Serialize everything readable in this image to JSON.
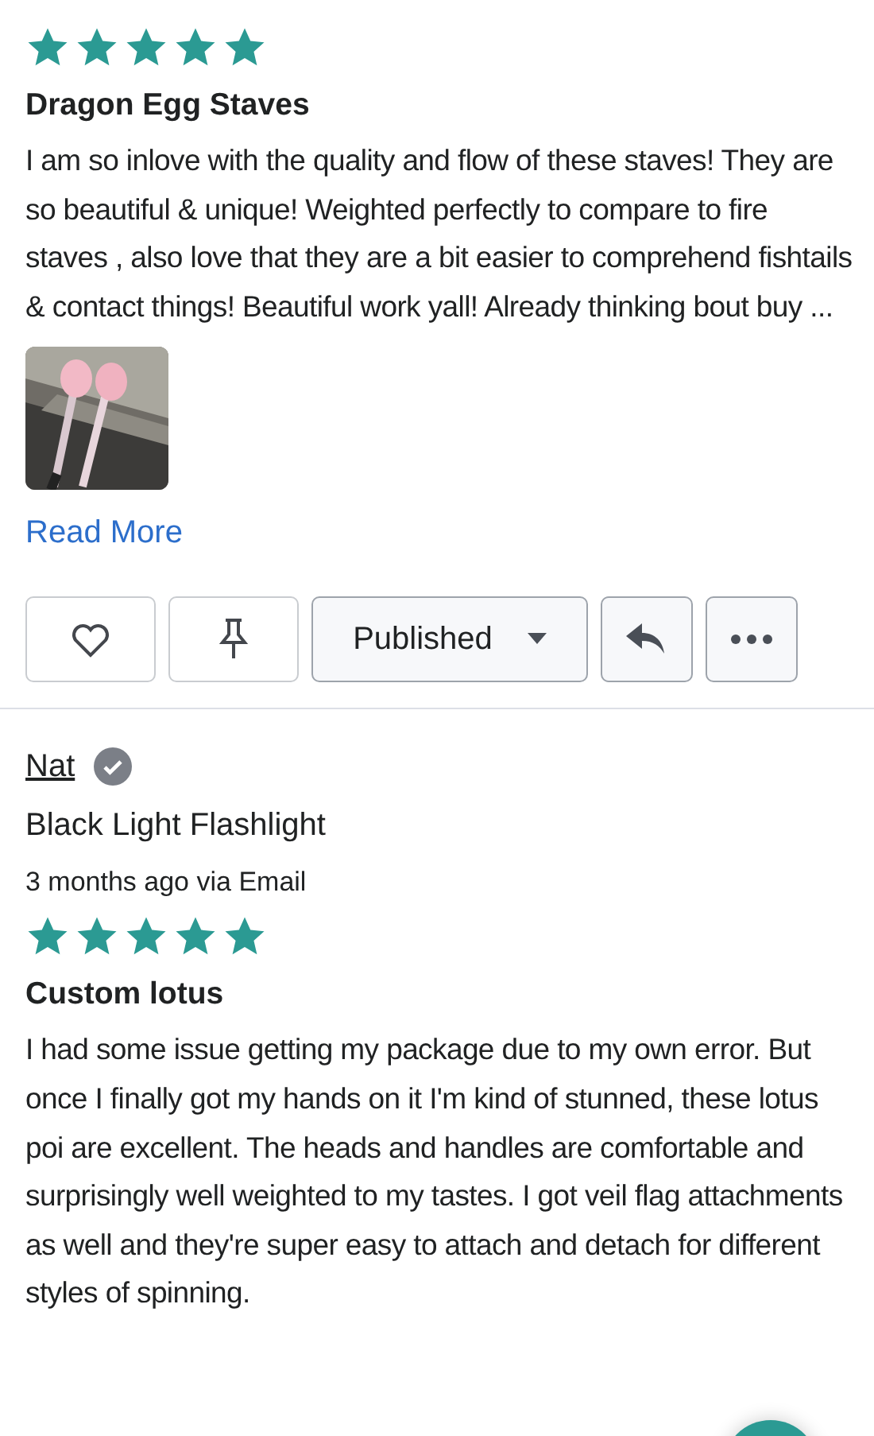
{
  "reviews": [
    {
      "stars": 5,
      "title": "Dragon Egg Staves",
      "body": "I am so inlove with the quality and flow of these staves! They are so beautiful & unique! Weighted perfectly to compare to fire staves , also love that they are a bit easier to comprehend fishtails & contact things! Beautiful work yall! Already thinking bout buy ...",
      "photos": [
        {
          "kind": "picture"
        }
      ],
      "read_more": "Read More",
      "actions": {
        "status": "Published"
      }
    },
    {
      "author": "Nat",
      "verified": true,
      "product": "Black Light Flashlight",
      "meta": "3 months ago via Email",
      "stars": 5,
      "title": "Custom lotus",
      "body": "I had some issue getting my package due to my own error. But once I finally got my hands on it I'm kind of stunned, these lotus poi are excellent. The heads and handles are comfortable and surprisingly well weighted to my tastes. I got veil flag attachments as well and they're super easy to attach and detach for different styles of spinning."
    }
  ]
}
